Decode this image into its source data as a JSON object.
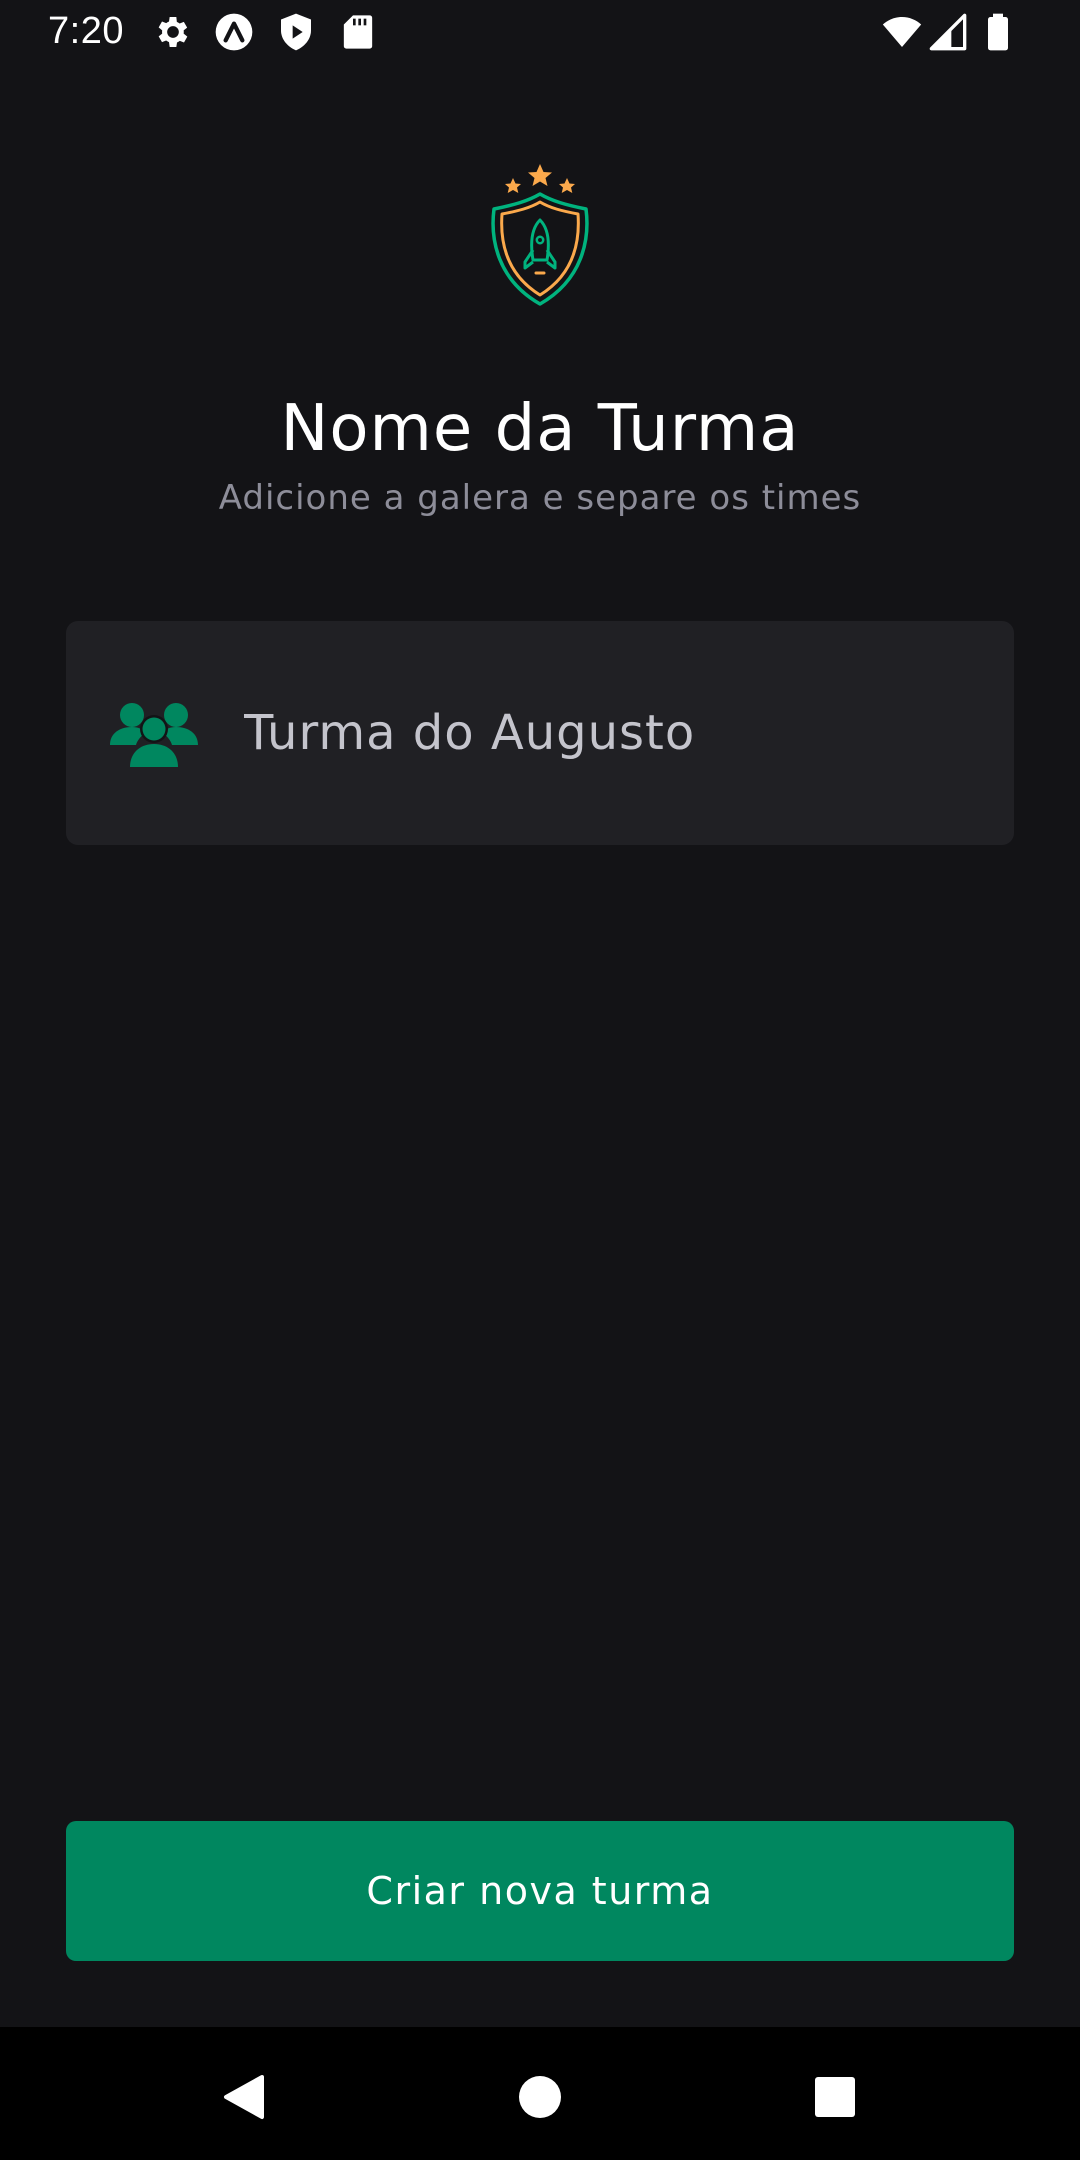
{
  "status_bar": {
    "time": "7:20",
    "left_icons": [
      "gear-icon",
      "expo-a-icon",
      "shield-play-icon",
      "sd-card-icon"
    ],
    "right_icons": [
      "wifi-icon",
      "cellular-signal-icon",
      "battery-icon"
    ]
  },
  "header": {
    "logo_icon": "rocket-shield-logo-icon",
    "title": "Nome da Turma",
    "subtitle": "Adicione a galera e separe os times"
  },
  "form": {
    "input_icon": "users-icon",
    "input_placeholder": "",
    "input_value": "Turma do Augusto"
  },
  "actions": {
    "create_button_label": "Criar nova turma"
  },
  "nav_bar": {
    "buttons": [
      "back-icon",
      "home-icon",
      "recents-icon"
    ]
  },
  "colors": {
    "background": "#131316",
    "input_background": "#202024",
    "primary": "#00875F",
    "title": "#FFFFFF",
    "subtitle": "#8D8D99",
    "star": "#FBA94C"
  }
}
